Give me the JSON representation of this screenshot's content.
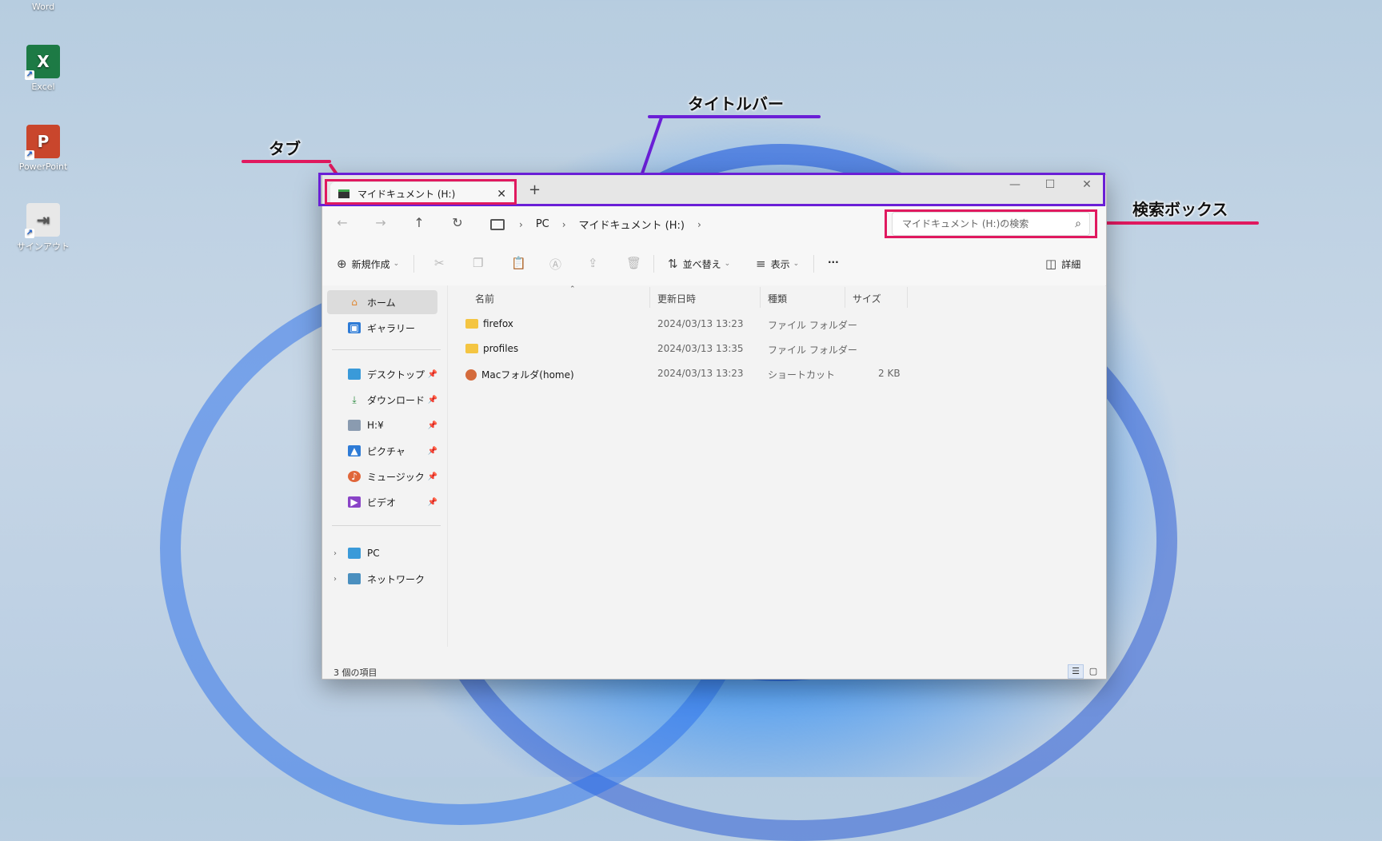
{
  "desktop": {
    "icons": [
      {
        "label": "Word",
        "icon": "word-icon"
      },
      {
        "label": "Excel",
        "icon": "excel-icon",
        "glyph": "X",
        "color": "#1d7a45"
      },
      {
        "label": "PowerPoint",
        "icon": "powerpoint-icon",
        "glyph": "P",
        "color": "#c9462c"
      },
      {
        "label": "サインアウト",
        "icon": "signout-icon",
        "glyph": "⇥",
        "color": "#e8e8e8"
      }
    ]
  },
  "annotations": {
    "tab": "タブ",
    "titlebar": "タイトルバー",
    "searchbox": "検索ボックス",
    "colors": {
      "tab": "#e0195f",
      "titlebar": "#6a1fd6",
      "searchbox": "#e0195f"
    }
  },
  "window": {
    "tab_title": "マイドキュメント (H:)",
    "tab_close": "✕",
    "new_tab": "+",
    "controls": {
      "minimize": "—",
      "maximize": "☐",
      "close": "✕"
    }
  },
  "address": {
    "back": "←",
    "forward": "→",
    "up": "↑",
    "refresh": "↻",
    "breadcrumb": [
      "PC",
      "マイドキュメント (H:)"
    ],
    "sep": "›",
    "search_placeholder": "マイドキュメント (H:)の検索",
    "search_icon": "⌕"
  },
  "toolbar": {
    "new_label": "新規作成",
    "sort_label": "並べ替え",
    "view_label": "表示",
    "more_label": "···",
    "details_label": "詳細",
    "icons": [
      "cut-icon",
      "copy-icon",
      "paste-icon",
      "rename-icon",
      "share-icon",
      "delete-icon"
    ]
  },
  "sidebar": {
    "items": [
      {
        "label": "ホーム",
        "icon": "home-icon",
        "selected": true
      },
      {
        "label": "ギャラリー",
        "icon": "gallery-icon"
      },
      {
        "label": "デスクトップ",
        "icon": "desktop-icon",
        "pinned": true
      },
      {
        "label": "ダウンロード",
        "icon": "download-icon",
        "pinned": true
      },
      {
        "label": "H:¥",
        "icon": "drive-icon",
        "pinned": true
      },
      {
        "label": "ピクチャ",
        "icon": "pictures-icon",
        "pinned": true
      },
      {
        "label": "ミュージック",
        "icon": "music-icon",
        "pinned": true
      },
      {
        "label": "ビデオ",
        "icon": "videos-icon",
        "pinned": true
      },
      {
        "label": "PC",
        "icon": "pc-icon",
        "expandable": true
      },
      {
        "label": "ネットワーク",
        "icon": "network-icon",
        "expandable": true
      }
    ]
  },
  "filelist": {
    "columns": [
      "名前",
      "更新日時",
      "種類",
      "サイズ"
    ],
    "rows": [
      {
        "name": "firefox",
        "date": "2024/03/13 13:23",
        "type": "ファイル フォルダー",
        "size": "",
        "icon": "folder-icon"
      },
      {
        "name": "profiles",
        "date": "2024/03/13 13:35",
        "type": "ファイル フォルダー",
        "size": "",
        "icon": "folder-icon"
      },
      {
        "name": "Macフォルダ(home)",
        "date": "2024/03/13 13:23",
        "type": "ショートカット",
        "size": "2 KB",
        "icon": "shortcut-icon"
      }
    ]
  },
  "status": {
    "item_count": "3 個の項目"
  }
}
